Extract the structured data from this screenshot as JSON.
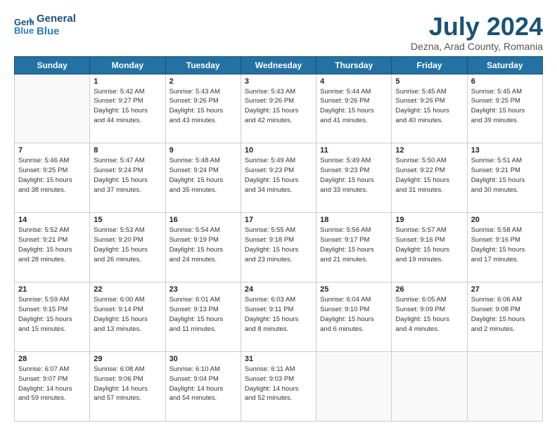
{
  "header": {
    "logo_line1": "General",
    "logo_line2": "Blue",
    "title": "July 2024",
    "subtitle": "Dezna, Arad County, Romania"
  },
  "weekdays": [
    "Sunday",
    "Monday",
    "Tuesday",
    "Wednesday",
    "Thursday",
    "Friday",
    "Saturday"
  ],
  "weeks": [
    [
      {
        "day": "",
        "info": ""
      },
      {
        "day": "1",
        "info": "Sunrise: 5:42 AM\nSunset: 9:27 PM\nDaylight: 15 hours\nand 44 minutes."
      },
      {
        "day": "2",
        "info": "Sunrise: 5:43 AM\nSunset: 9:26 PM\nDaylight: 15 hours\nand 43 minutes."
      },
      {
        "day": "3",
        "info": "Sunrise: 5:43 AM\nSunset: 9:26 PM\nDaylight: 15 hours\nand 42 minutes."
      },
      {
        "day": "4",
        "info": "Sunrise: 5:44 AM\nSunset: 9:26 PM\nDaylight: 15 hours\nand 41 minutes."
      },
      {
        "day": "5",
        "info": "Sunrise: 5:45 AM\nSunset: 9:26 PM\nDaylight: 15 hours\nand 40 minutes."
      },
      {
        "day": "6",
        "info": "Sunrise: 5:45 AM\nSunset: 9:25 PM\nDaylight: 15 hours\nand 39 minutes."
      }
    ],
    [
      {
        "day": "7",
        "info": "Sunrise: 5:46 AM\nSunset: 9:25 PM\nDaylight: 15 hours\nand 38 minutes."
      },
      {
        "day": "8",
        "info": "Sunrise: 5:47 AM\nSunset: 9:24 PM\nDaylight: 15 hours\nand 37 minutes."
      },
      {
        "day": "9",
        "info": "Sunrise: 5:48 AM\nSunset: 9:24 PM\nDaylight: 15 hours\nand 35 minutes."
      },
      {
        "day": "10",
        "info": "Sunrise: 5:49 AM\nSunset: 9:23 PM\nDaylight: 15 hours\nand 34 minutes."
      },
      {
        "day": "11",
        "info": "Sunrise: 5:49 AM\nSunset: 9:23 PM\nDaylight: 15 hours\nand 33 minutes."
      },
      {
        "day": "12",
        "info": "Sunrise: 5:50 AM\nSunset: 9:22 PM\nDaylight: 15 hours\nand 31 minutes."
      },
      {
        "day": "13",
        "info": "Sunrise: 5:51 AM\nSunset: 9:21 PM\nDaylight: 15 hours\nand 30 minutes."
      }
    ],
    [
      {
        "day": "14",
        "info": "Sunrise: 5:52 AM\nSunset: 9:21 PM\nDaylight: 15 hours\nand 28 minutes."
      },
      {
        "day": "15",
        "info": "Sunrise: 5:53 AM\nSunset: 9:20 PM\nDaylight: 15 hours\nand 26 minutes."
      },
      {
        "day": "16",
        "info": "Sunrise: 5:54 AM\nSunset: 9:19 PM\nDaylight: 15 hours\nand 24 minutes."
      },
      {
        "day": "17",
        "info": "Sunrise: 5:55 AM\nSunset: 9:18 PM\nDaylight: 15 hours\nand 23 minutes."
      },
      {
        "day": "18",
        "info": "Sunrise: 5:56 AM\nSunset: 9:17 PM\nDaylight: 15 hours\nand 21 minutes."
      },
      {
        "day": "19",
        "info": "Sunrise: 5:57 AM\nSunset: 9:16 PM\nDaylight: 15 hours\nand 19 minutes."
      },
      {
        "day": "20",
        "info": "Sunrise: 5:58 AM\nSunset: 9:16 PM\nDaylight: 15 hours\nand 17 minutes."
      }
    ],
    [
      {
        "day": "21",
        "info": "Sunrise: 5:59 AM\nSunset: 9:15 PM\nDaylight: 15 hours\nand 15 minutes."
      },
      {
        "day": "22",
        "info": "Sunrise: 6:00 AM\nSunset: 9:14 PM\nDaylight: 15 hours\nand 13 minutes."
      },
      {
        "day": "23",
        "info": "Sunrise: 6:01 AM\nSunset: 9:13 PM\nDaylight: 15 hours\nand 11 minutes."
      },
      {
        "day": "24",
        "info": "Sunrise: 6:03 AM\nSunset: 9:11 PM\nDaylight: 15 hours\nand 8 minutes."
      },
      {
        "day": "25",
        "info": "Sunrise: 6:04 AM\nSunset: 9:10 PM\nDaylight: 15 hours\nand 6 minutes."
      },
      {
        "day": "26",
        "info": "Sunrise: 6:05 AM\nSunset: 9:09 PM\nDaylight: 15 hours\nand 4 minutes."
      },
      {
        "day": "27",
        "info": "Sunrise: 6:06 AM\nSunset: 9:08 PM\nDaylight: 15 hours\nand 2 minutes."
      }
    ],
    [
      {
        "day": "28",
        "info": "Sunrise: 6:07 AM\nSunset: 9:07 PM\nDaylight: 14 hours\nand 59 minutes."
      },
      {
        "day": "29",
        "info": "Sunrise: 6:08 AM\nSunset: 9:06 PM\nDaylight: 14 hours\nand 57 minutes."
      },
      {
        "day": "30",
        "info": "Sunrise: 6:10 AM\nSunset: 9:04 PM\nDaylight: 14 hours\nand 54 minutes."
      },
      {
        "day": "31",
        "info": "Sunrise: 6:11 AM\nSunset: 9:03 PM\nDaylight: 14 hours\nand 52 minutes."
      },
      {
        "day": "",
        "info": ""
      },
      {
        "day": "",
        "info": ""
      },
      {
        "day": "",
        "info": ""
      }
    ]
  ]
}
